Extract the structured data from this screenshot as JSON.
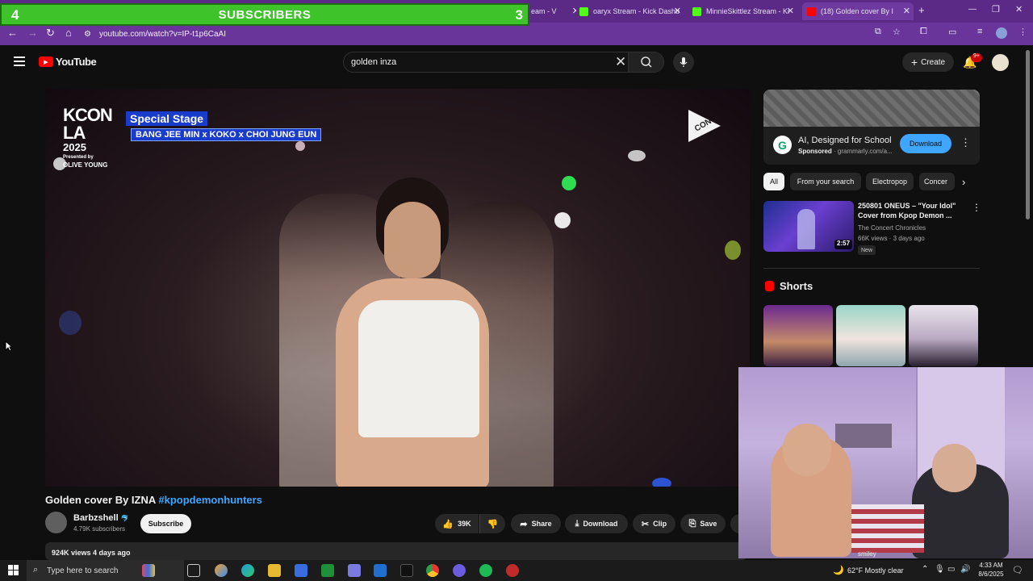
{
  "browser": {
    "tabs": [
      {
        "label": "eam - V",
        "active": false
      },
      {
        "label": "oaryx Stream - Kick Dashb",
        "active": false
      },
      {
        "label": "MinnieSkittlez Stream - Ki",
        "active": false
      },
      {
        "label": "(18) Golden cover By I",
        "active": true
      }
    ],
    "url": "youtube.com/watch?v=IP-t1p6CaAI"
  },
  "overlay": {
    "left_count": "4",
    "label": "SUBSCRIBERS",
    "right_count": "3"
  },
  "youtube": {
    "logo_text": "YouTube",
    "search_value": "golden  inza",
    "create_label": "Create",
    "notif_badge": "9+"
  },
  "video": {
    "kcon_line1": "KCON",
    "kcon_line2": "LA",
    "kcon_line3": "2025",
    "presented_by": "Presented by",
    "sponsor": "OLIVE YOUNG",
    "stage_title": "Special Stage",
    "performers": "BANG JEE MIN x KOKO x CHOI JUNG EUN",
    "corner_logo": "CON"
  },
  "watch": {
    "title_plain": "Golden cover By IZNA ",
    "title_tag": "#kpopdemonhunters",
    "channel": "Barbzshell",
    "channel_badge": "🐬",
    "subscribers": "4.79K subscribers",
    "subscribe_label": "Subscribe",
    "likes": "39K",
    "share_label": "Share",
    "download_label": "Download",
    "clip_label": "Clip",
    "save_label": "Save",
    "views_line": "924K views  4 days ago"
  },
  "ad": {
    "headline": "AI, Designed for School",
    "sponsored": "Sponsored",
    "domain": "· grammarly.com/a...",
    "cta": "Download",
    "logo_letter": "G"
  },
  "chips": [
    "All",
    "From your search",
    "Electropop",
    "Concer"
  ],
  "recommendation": {
    "title": "250801 ONEUS – \"Your Idol\" Cover from Kpop Demon ...",
    "channel": "The Concert Chronicles",
    "meta": "66K views · 3 days ago",
    "badge": "New",
    "duration": "2:57"
  },
  "shorts_heading": "Shorts",
  "webcam": {
    "caption": "smiley"
  },
  "taskbar": {
    "search_placeholder": "Type here to search",
    "weather": "62°F  Mostly clear",
    "time": "4:33 AM",
    "date": "8/6/2025"
  },
  "colors": {
    "overlay_green": "#3ec42a",
    "browser_purple": "#6a359b",
    "youtube_red": "#ff0000",
    "link_blue": "#3ea6ff"
  }
}
